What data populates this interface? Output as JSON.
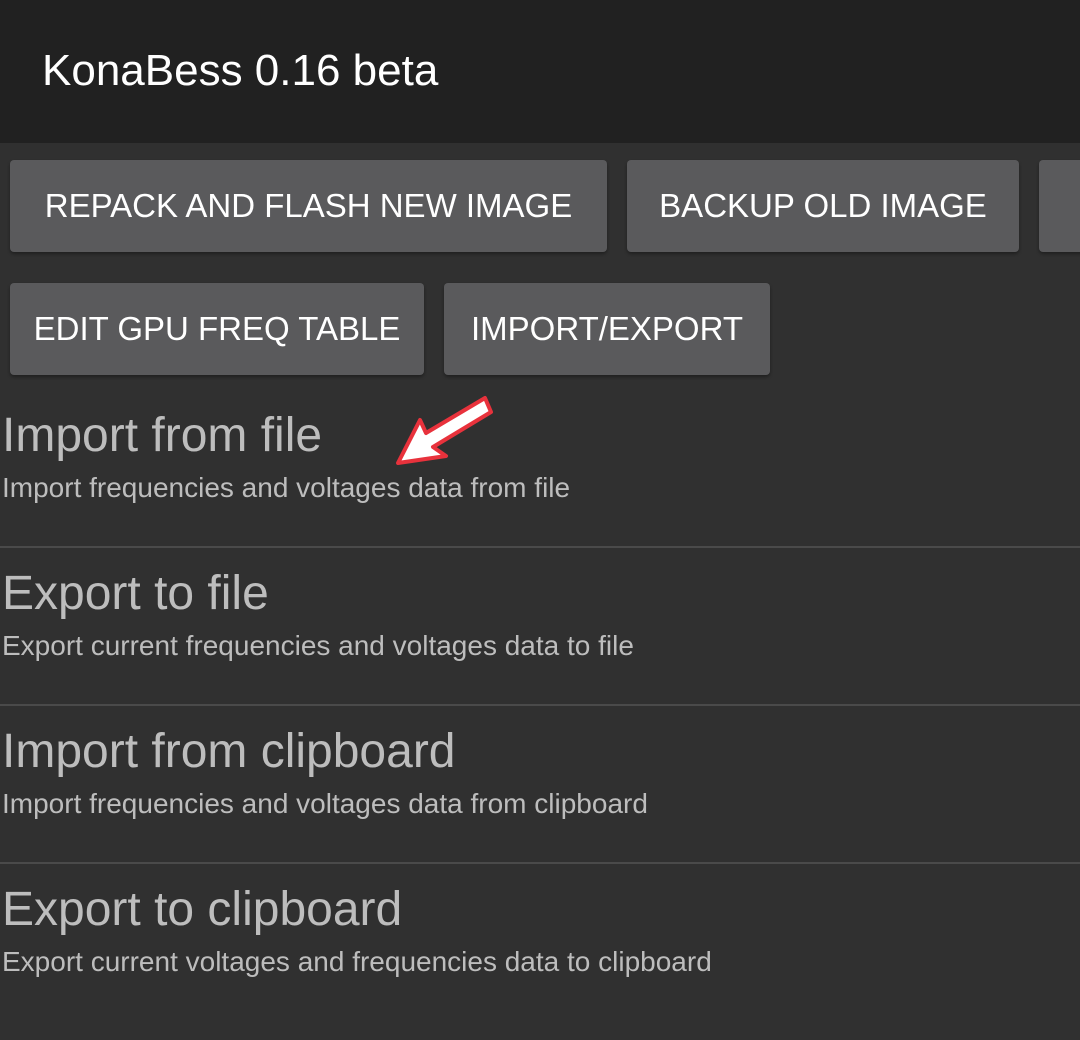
{
  "app_bar": {
    "title": "KonaBess 0.16 beta"
  },
  "buttons": {
    "repack": "REPACK AND FLASH NEW IMAGE",
    "backup": "BACKUP OLD IMAGE",
    "edit_table": "EDIT GPU FREQ TABLE",
    "import_export": "IMPORT/EXPORT"
  },
  "items": [
    {
      "title": "Import from file",
      "subtitle": "Import frequencies and voltages data from file"
    },
    {
      "title": "Export to file",
      "subtitle": "Export current frequencies and voltages data to file"
    },
    {
      "title": "Import from clipboard",
      "subtitle": "Import frequencies and voltages data from clipboard"
    },
    {
      "title": "Export to clipboard",
      "subtitle": "Export current voltages and frequencies data to clipboard"
    }
  ],
  "annotation": {
    "arrow_color": "#e8323c"
  }
}
